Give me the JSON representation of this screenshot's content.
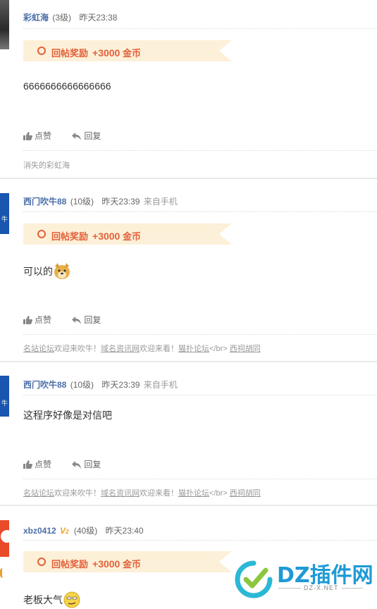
{
  "reward_label": "回帖奖励",
  "reward_amount": "+3000",
  "reward_unit": "金币",
  "like_label": "点赞",
  "reply_label": "回复",
  "posts": [
    {
      "username": "彩虹海",
      "level": "(3级)",
      "time": "昨天23:38",
      "source": "",
      "content": "6666666666666666",
      "signature": "消失的彩虹海"
    },
    {
      "username": "西门吹牛88",
      "level": "(10级)",
      "time": "昨天23:39",
      "source": "来自手机",
      "content": "可以的",
      "signature": {
        "link1": "名站论坛",
        "text1": "欢迎来吹牛！",
        "link2": "域名资讯网",
        "text2": "欢迎来看！",
        "link3": "猫扑论坛",
        "text3": "</br>",
        "link4": "西祠胡同"
      }
    },
    {
      "username": "西门吹牛88",
      "level": "(10级)",
      "time": "昨天23:39",
      "source": "来自手机",
      "content": "这程序好像是对信吧",
      "signature": {
        "link1": "名站论坛",
        "text1": "欢迎来吹牛！",
        "link2": "域名资讯网",
        "text2": "欢迎来看！",
        "link3": "猫扑论坛",
        "text3": "</br>",
        "link4": "西祠胡同"
      }
    },
    {
      "username": "xbz0412",
      "level": "(40级)",
      "time": "昨天23:40",
      "source": "",
      "content": "老板大气"
    }
  ],
  "watermark": {
    "brand": "DZ插件网",
    "domain": "DZ-X.NET"
  },
  "colors": {
    "username": "#4a6ea8",
    "reward": "#e3603a",
    "reward_bg": "#fdf0d8"
  }
}
